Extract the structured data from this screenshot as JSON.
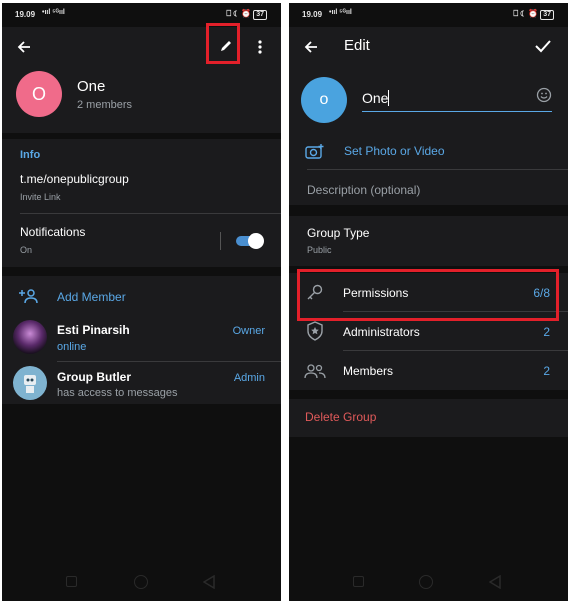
{
  "status": {
    "time": "19.09",
    "signal": "•ııl ⁵ᴳııl",
    "right_icons": "⎕ ☾ ⏰",
    "battery": "37"
  },
  "left": {
    "group_name": "One",
    "avatar_letter": "O",
    "members_count": "2 members",
    "info": {
      "header": "Info",
      "link": "t.me/onepublicgroup",
      "link_caption": "Invite Link",
      "notifications_label": "Notifications",
      "notifications_value": "On"
    },
    "add_member": "Add Member",
    "members": [
      {
        "name": "Esti Pinarsih",
        "status": "online",
        "role": "Owner"
      },
      {
        "name": "Group Butler",
        "status": "has access to messages",
        "role": "Admin"
      }
    ]
  },
  "right": {
    "title": "Edit",
    "avatar_letter": "o",
    "name_value": "One",
    "set_photo": "Set Photo or Video",
    "description_placeholder": "Description (optional)",
    "group_type_label": "Group Type",
    "group_type_value": "Public",
    "rows": [
      {
        "label": "Permissions",
        "value": "6/8",
        "icon": "key-icon"
      },
      {
        "label": "Administrators",
        "value": "2",
        "icon": "shield-star-icon"
      },
      {
        "label": "Members",
        "value": "2",
        "icon": "people-icon"
      }
    ],
    "delete": "Delete Group"
  },
  "colors": {
    "accent": "#5aa8e6",
    "avatar_pink": "#f06b8a",
    "avatar_blue": "#4aa3df",
    "danger": "#e05a5a",
    "highlight": "#e3202a"
  }
}
